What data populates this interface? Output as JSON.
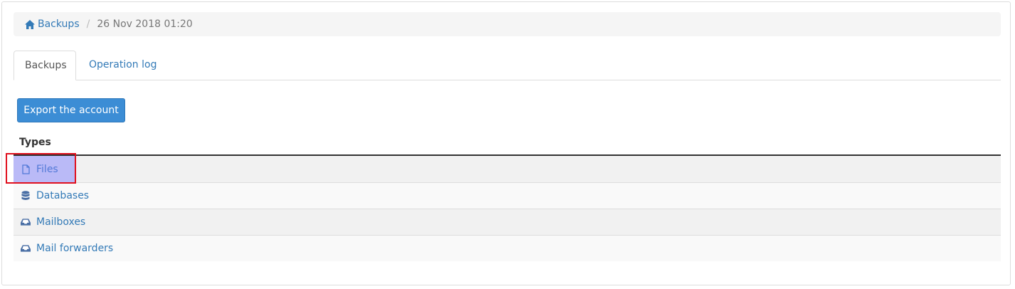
{
  "breadcrumb": {
    "home_label": "Backups",
    "home_icon": "home-icon",
    "separator": "/",
    "current": "26 Nov 2018 01:20"
  },
  "tabs": [
    {
      "label": "Backups",
      "active": true
    },
    {
      "label": "Operation log",
      "active": false
    }
  ],
  "export_button": {
    "label": "Export the account"
  },
  "types_table": {
    "header": "Types",
    "rows": [
      {
        "label": "Files",
        "icon": "file-icon",
        "highlighted": true
      },
      {
        "label": "Databases",
        "icon": "database-icon",
        "highlighted": false
      },
      {
        "label": "Mailboxes",
        "icon": "inbox-icon",
        "highlighted": false
      },
      {
        "label": "Mail forwarders",
        "icon": "inbox-icon",
        "highlighted": false
      }
    ]
  },
  "colors": {
    "link": "#337ab7",
    "primary_button": "#3c8dd5",
    "highlight_border": "#e0101e",
    "highlight_fill": "#7878ff"
  }
}
